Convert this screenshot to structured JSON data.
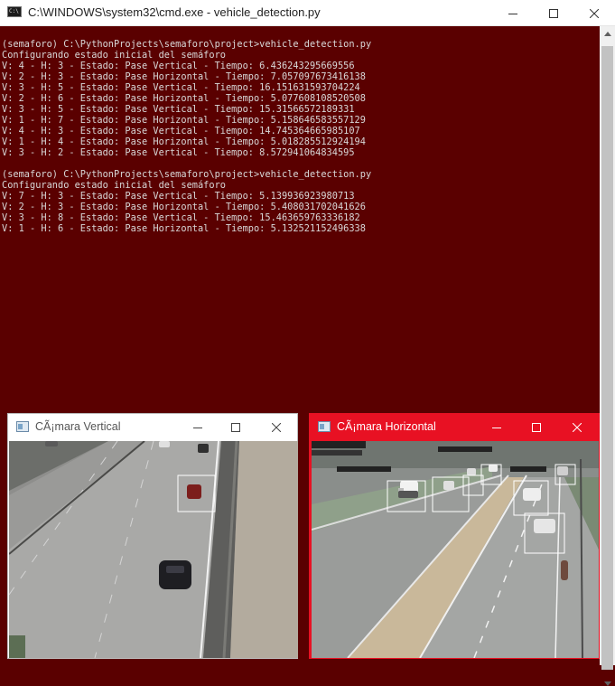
{
  "cmd_window": {
    "title": "C:\\WINDOWS\\system32\\cmd.exe - vehicle_detection.py",
    "icon": "console-app-icon",
    "minimize_icon": "minimize-icon",
    "maximize_icon": "maximize-icon",
    "close_icon": "close-icon"
  },
  "console": {
    "lines": [
      "(semaforo) C:\\PythonProjects\\semaforo\\project>vehicle_detection.py",
      "Configurando estado inicial del semáforo",
      "V: 4 - H: 3 - Estado: Pase Vertical - Tiempo: 6.436243295669556",
      "V: 2 - H: 3 - Estado: Pase Horizontal - Tiempo: 7.057097673416138",
      "V: 3 - H: 5 - Estado: Pase Vertical - Tiempo: 16.151631593704224",
      "V: 2 - H: 6 - Estado: Pase Horizontal - Tiempo: 5.077608108520508",
      "V: 3 - H: 5 - Estado: Pase Vertical - Tiempo: 15.31566572189331",
      "V: 1 - H: 7 - Estado: Pase Horizontal - Tiempo: 5.158646583557129",
      "V: 4 - H: 3 - Estado: Pase Vertical - Tiempo: 14.745364665985107",
      "V: 1 - H: 4 - Estado: Pase Horizontal - Tiempo: 5.018285512924194",
      "V: 3 - H: 2 - Estado: Pase Vertical - Tiempo: 8.572941064834595",
      "",
      "(semaforo) C:\\PythonProjects\\semaforo\\project>vehicle_detection.py",
      "Configurando estado inicial del semáforo",
      "V: 7 - H: 3 - Estado: Pase Vertical - Tiempo: 5.139936923980713",
      "V: 2 - H: 3 - Estado: Pase Horizontal - Tiempo: 5.408031702041626",
      "V: 3 - H: 8 - Estado: Pase Vertical - Tiempo: 15.463659763336182",
      "V: 1 - H: 6 - Estado: Pase Horizontal - Tiempo: 5.132521152496338"
    ]
  },
  "camera_vertical": {
    "title": "CÃ¡mara Vertical",
    "icon": "image-window-icon",
    "state": "inactive"
  },
  "camera_horizontal": {
    "title": "CÃ¡mara Horizontal",
    "icon": "image-window-icon",
    "state": "active"
  },
  "colors": {
    "console_bg": "#5a0000",
    "console_text": "#d8d8d8",
    "active_title": "#e81123",
    "detection_box": "#ffffff"
  }
}
